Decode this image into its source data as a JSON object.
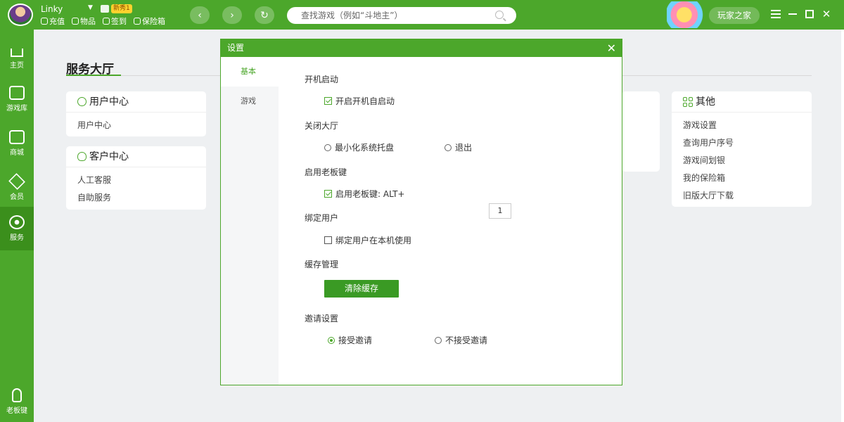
{
  "user": {
    "name": "Linky",
    "badge": "新秀1",
    "links": [
      "充值",
      "物品",
      "签到",
      "保险箱"
    ]
  },
  "search": {
    "placeholder": "查找游戏（例如“斗地主”）"
  },
  "header": {
    "player_home": "玩家之家"
  },
  "sidebar": {
    "items": [
      {
        "label": "主页",
        "icon": "home-icon"
      },
      {
        "label": "游戏库",
        "icon": "gamepad-icon"
      },
      {
        "label": "商城",
        "icon": "mail-icon"
      },
      {
        "label": "会员",
        "icon": "diamond-icon"
      },
      {
        "label": "服务",
        "icon": "eye-icon",
        "active": true
      },
      {
        "label": "老板键",
        "icon": "hand-icon"
      }
    ]
  },
  "main": {
    "title": "服务大厅",
    "user_center": {
      "title": "用户中心",
      "items": [
        "用户中心"
      ]
    },
    "customer_center": {
      "title": "客户中心",
      "items": [
        "人工客服",
        "自助服务"
      ]
    },
    "other": {
      "title": "其他",
      "items": [
        "游戏设置",
        "查询用户序号",
        "游戏间划银",
        "我的保险箱",
        "旧版大厅下载"
      ]
    }
  },
  "dialog": {
    "title": "设置",
    "tabs": [
      "基本",
      "游戏"
    ],
    "sections": {
      "startup": {
        "title": "开机启动",
        "option": "开启开机自启动",
        "checked": true
      },
      "close": {
        "title": "关闭大厅",
        "option1": "最小化系统托盘",
        "option2": "退出"
      },
      "bosskey": {
        "title": "启用老板键",
        "option": "启用老板键: ALT+",
        "checked": true,
        "key": "1"
      },
      "bind": {
        "title": "绑定用户",
        "option": "绑定用户在本机使用",
        "checked": false
      },
      "cache": {
        "title": "缓存管理",
        "button": "清除缓存"
      },
      "invite": {
        "title": "邀请设置",
        "option1": "接受邀请",
        "option2": "不接受邀请",
        "selected": "接受邀请"
      }
    }
  },
  "colors": {
    "brand": "#4ca72b",
    "brand_dark": "#3b8f1c",
    "background": "#eef0f2"
  }
}
